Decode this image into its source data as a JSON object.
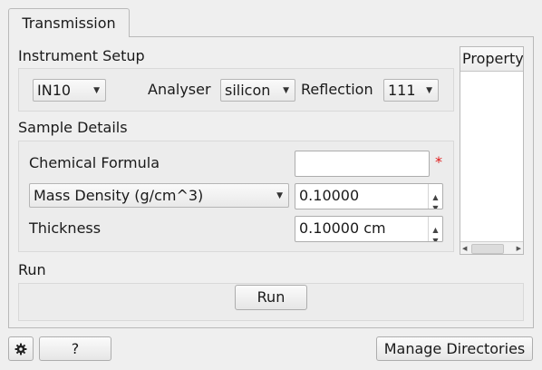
{
  "tabs": [
    {
      "label": "Transmission"
    }
  ],
  "instrument_setup": {
    "title": "Instrument Setup",
    "instrument": {
      "value": "IN10"
    },
    "analyser": {
      "label": "Analyser",
      "value": "silicon"
    },
    "reflection": {
      "label": "Reflection",
      "value": "111"
    }
  },
  "sample_details": {
    "title": "Sample Details",
    "chemical_formula": {
      "label": "Chemical Formula",
      "value": "",
      "required_marker": "*"
    },
    "density": {
      "type_value": "Mass Density (g/cm^3)",
      "value": "0.10000"
    },
    "thickness": {
      "label": "Thickness",
      "value": "0.10000 cm"
    }
  },
  "run_section": {
    "title": "Run",
    "button_label": "Run"
  },
  "property_table": {
    "header": "Property"
  },
  "footer": {
    "help_label": "?",
    "manage_label": "Manage Directories"
  },
  "icons": {
    "settings": "gear-icon",
    "dropdown": "chevron-down-icon",
    "spin_up": "arrow-up-icon",
    "spin_down": "arrow-down-icon"
  }
}
